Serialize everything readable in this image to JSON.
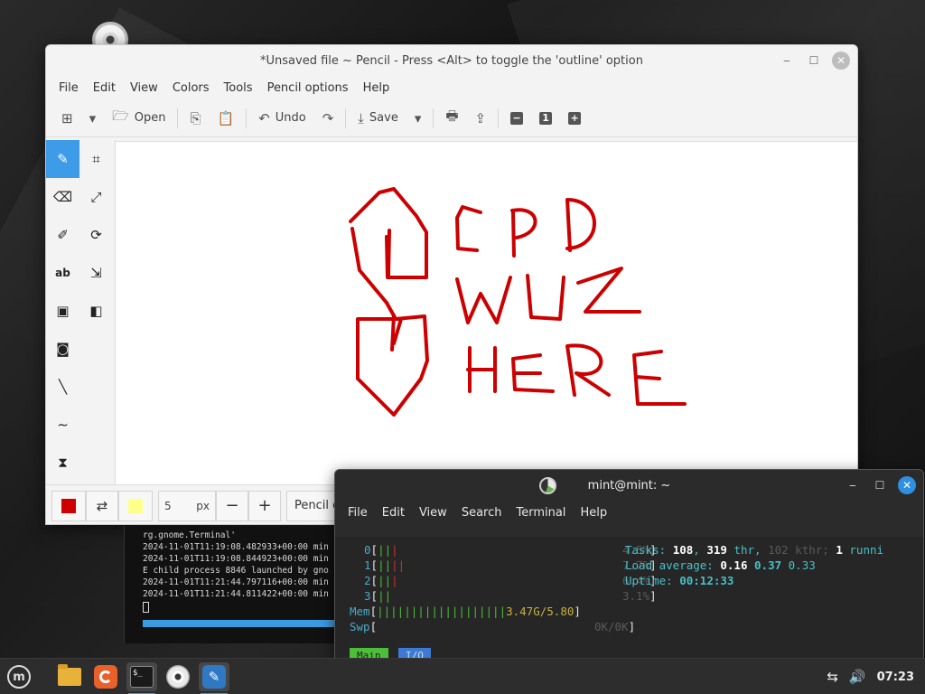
{
  "pencil": {
    "title": "*Unsaved file ~ Pencil - Press <Alt> to toggle the 'outline' option",
    "menu": [
      "File",
      "Edit",
      "View",
      "Colors",
      "Tools",
      "Pencil options",
      "Help"
    ],
    "toolbar": {
      "open_label": "Open",
      "undo_label": "Undo",
      "save_label": "Save",
      "zoom_value": "1"
    },
    "bottom": {
      "size_value": "5",
      "size_unit": "px",
      "minus": "−",
      "plus": "+",
      "font_label": "Pencil o",
      "main_color": "#cc0000",
      "secondary_color": "#ffff8c"
    },
    "drawing_text": [
      "CPD",
      "WUZ",
      "HERE"
    ],
    "drawing_color": "#cc0000"
  },
  "old_terminal": {
    "lines": [
      "rg.gnome.Terminal'",
      "2024-11-01T11:19:08.482933+00:00 min",
      "2024-11-01T11:19:08.844923+00:00 min",
      "E child process 8846 launched by gno",
      "2024-11-01T11:21:44.797116+00:00 min",
      "2024-11-01T11:21:44.811422+00:00 min"
    ]
  },
  "terminal": {
    "title": "mint@mint: ~",
    "menu": [
      "File",
      "Edit",
      "View",
      "Search",
      "Terminal",
      "Help"
    ],
    "htop": {
      "cpus": [
        {
          "id": "0",
          "percent": "4.5%"
        },
        {
          "id": "1",
          "percent": "7.7%"
        },
        {
          "id": "2",
          "percent": "6.4%"
        },
        {
          "id": "3",
          "percent": "3.1%"
        }
      ],
      "mem_label": "Mem",
      "mem_value": "3.47G/5.80",
      "swp_label": "Swp",
      "swp_value": "0K/0K",
      "tasks_label": "Tasks:",
      "tasks_count": "108",
      "threads": "319",
      "thr_label": "thr,",
      "kthr": "102 kthr;",
      "running": "1",
      "running_label": "runni",
      "load_label": "Load average:",
      "load1": "0.16",
      "load5": "0.37",
      "load15": "0.33",
      "uptime_label": "Uptime:",
      "uptime": "00:12:33",
      "tab_main": "Main",
      "tab_io": "I/O"
    }
  },
  "taskbar": {
    "clock": "07:23"
  }
}
